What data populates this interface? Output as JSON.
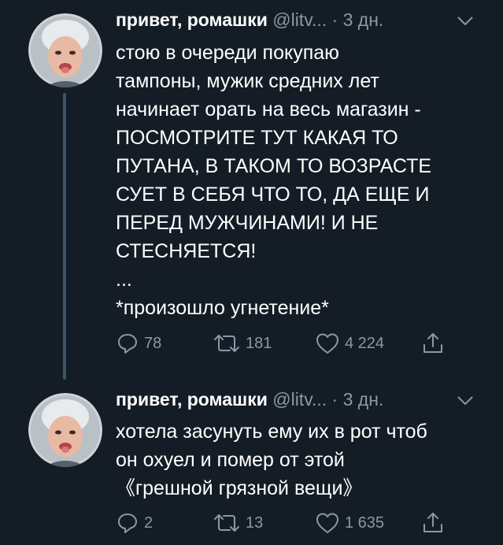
{
  "tweets": [
    {
      "name": "привет, ромашки",
      "handle": "@litv...",
      "separator": "·",
      "time": "3 дн.",
      "lines": [
        "стою в очереди покупаю",
        "тампоны, мужик средних лет",
        "начинает орать на весь магазин -",
        "ПОСМОТРИТЕ ТУТ КАКАЯ ТО",
        "ПУТАНА, В ТАКОМ ТО ВОЗРАСТЕ",
        "СУЕТ В СЕБЯ ЧТО ТО, ДА ЕЩЕ И",
        "ПЕРЕД МУЖЧИНАМИ! И НЕ",
        "СТЕСНЯЕТСЯ!",
        "...",
        "*произошло угнетение*"
      ],
      "replies": "78",
      "retweets": "181",
      "likes": "4 224"
    },
    {
      "name": "привет, ромашки",
      "handle": "@litv...",
      "separator": "·",
      "time": "3 дн.",
      "lines": [
        "хотела засунуть ему их в рот чтоб",
        "он охуел и помер от этой",
        "《грешной грязной вещи》"
      ],
      "replies": "2",
      "retweets": "13",
      "likes": "1 635"
    }
  ],
  "colors": {
    "background": "#141d26",
    "text": "#ffffff",
    "secondary": "#8899a6",
    "thread_line": "#3d5466"
  },
  "icons": [
    "reply-icon",
    "retweet-icon",
    "like-icon",
    "share-icon",
    "chevron-down-icon"
  ]
}
